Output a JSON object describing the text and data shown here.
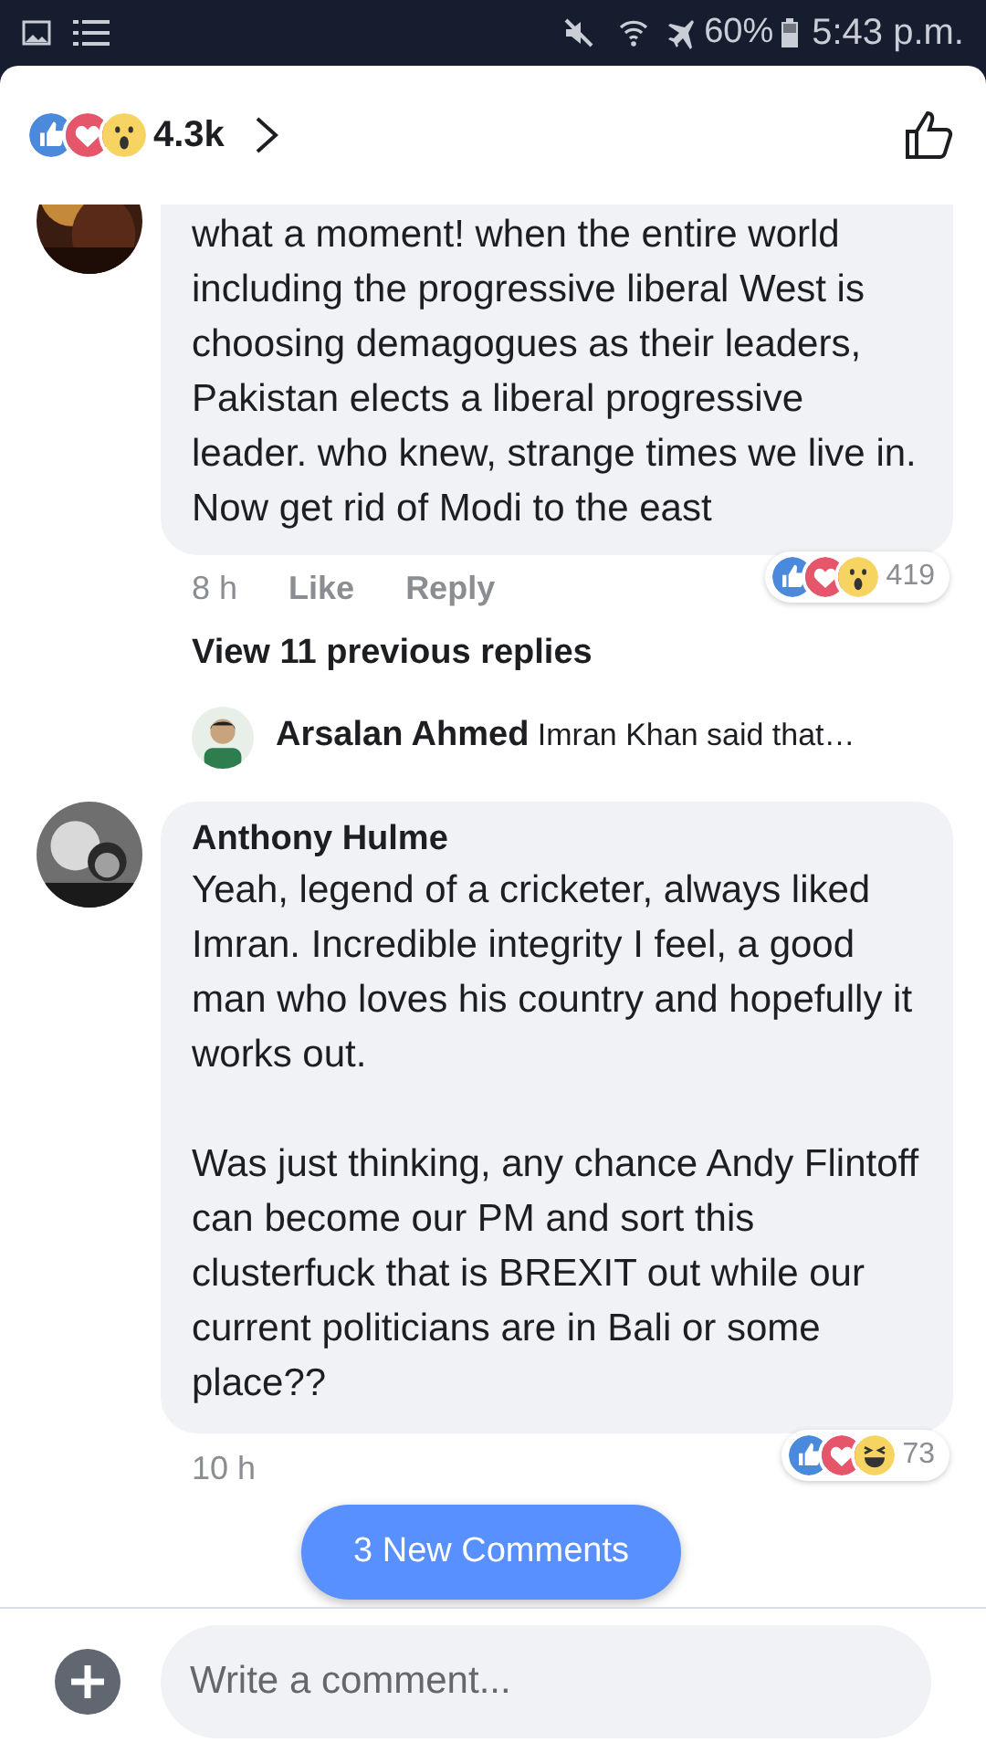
{
  "status_bar": {
    "battery": "60%",
    "time": "5:43 p.m."
  },
  "header": {
    "reactions": [
      {
        "kind": "like"
      },
      {
        "kind": "love"
      },
      {
        "kind": "wow"
      }
    ],
    "count": "4.3k"
  },
  "comments": [
    {
      "text": "what a moment! when the entire world including the progressive liberal West is choosing demagogues as their leaders, Pakistan elects a liberal progressive leader. who knew, strange times we live in. Now get rid of Modi to the east",
      "time": "8 h",
      "actions": [
        "Like",
        "Reply"
      ],
      "reactions": [
        {
          "kind": "like"
        },
        {
          "kind": "love"
        },
        {
          "kind": "wow"
        }
      ],
      "reaction_count": "419",
      "view_replies": "View 11 previous replies",
      "reply_preview": {
        "name": "Arsalan Ahmed",
        "text": "Imran Khan said that…"
      }
    },
    {
      "name": "Anthony Hulme",
      "paragraphs": [
        "Yeah, legend of a cricketer, always liked Imran. Incredible integrity I feel, a good man who loves his country and hopefully it works out.",
        "Was just thinking, any chance Andy Flintoff can become our PM and sort this clusterfuck that is BREXIT out while our current politicians are in Bali or some place??"
      ],
      "time": "10 h",
      "reactions": [
        {
          "kind": "like"
        },
        {
          "kind": "love"
        },
        {
          "kind": "haha"
        }
      ],
      "reaction_count": "73"
    }
  ],
  "new_comments_button": "3 New Comments",
  "composer": {
    "placeholder": "Write a comment..."
  }
}
